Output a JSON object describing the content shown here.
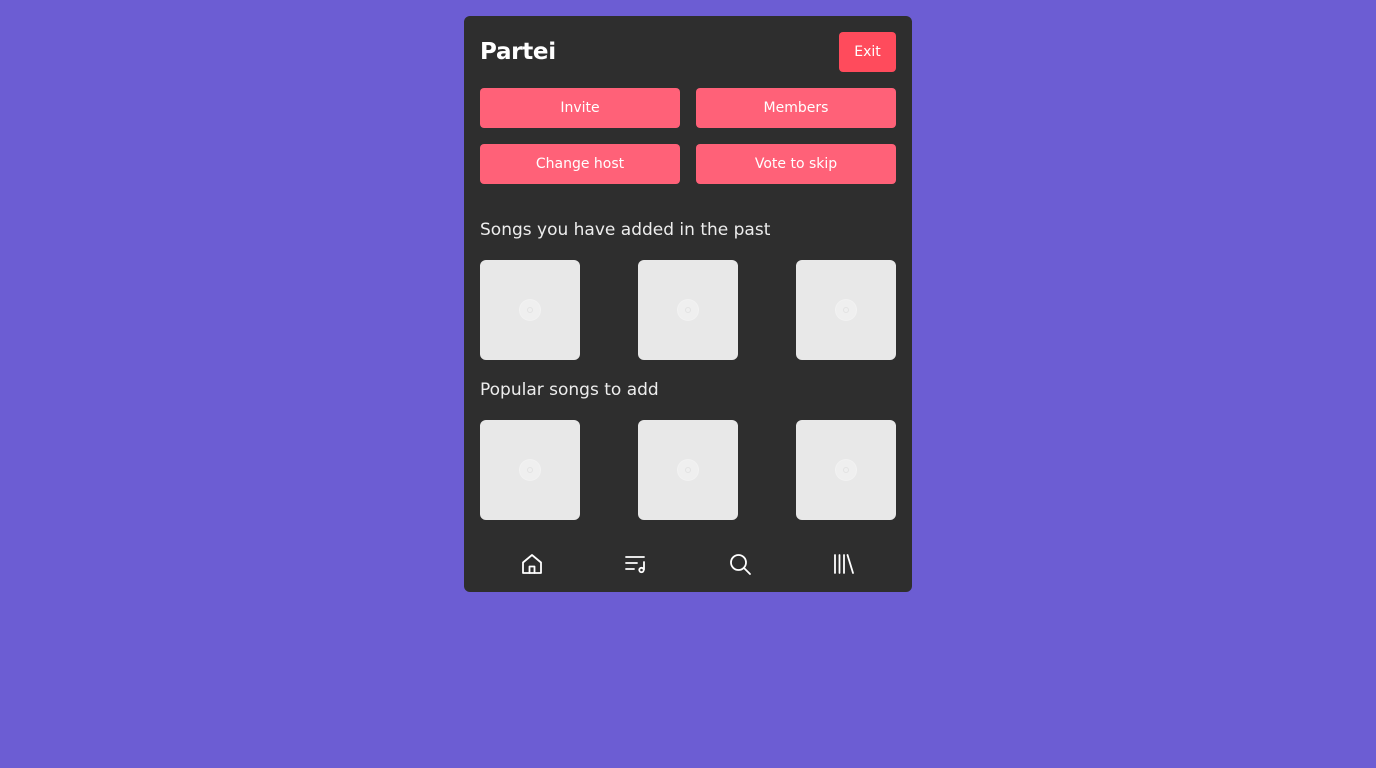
{
  "app": {
    "title": "Partei",
    "exit_label": "Exit"
  },
  "actions": {
    "invite_label": "Invite",
    "members_label": "Members",
    "change_host_label": "Change host",
    "vote_skip_label": "Vote to skip"
  },
  "sections": {
    "past_title": "Songs you have added in the past",
    "popular_title": "Popular songs to add"
  },
  "past_songs": [
    {
      "icon": "album-placeholder-icon"
    },
    {
      "icon": "album-placeholder-icon"
    },
    {
      "icon": "album-placeholder-icon"
    }
  ],
  "popular_songs": [
    {
      "icon": "album-placeholder-icon"
    },
    {
      "icon": "album-placeholder-icon"
    },
    {
      "icon": "album-placeholder-icon"
    }
  ],
  "nav": {
    "items": [
      {
        "icon": "home-icon"
      },
      {
        "icon": "queue-icon"
      },
      {
        "icon": "search-icon"
      },
      {
        "icon": "library-icon"
      }
    ]
  },
  "colors": {
    "background": "#6c5dd3",
    "panel": "#2e2e2e",
    "exit": "#ff4b5c",
    "action": "#ff6178",
    "tile": "#e8e8e8"
  }
}
